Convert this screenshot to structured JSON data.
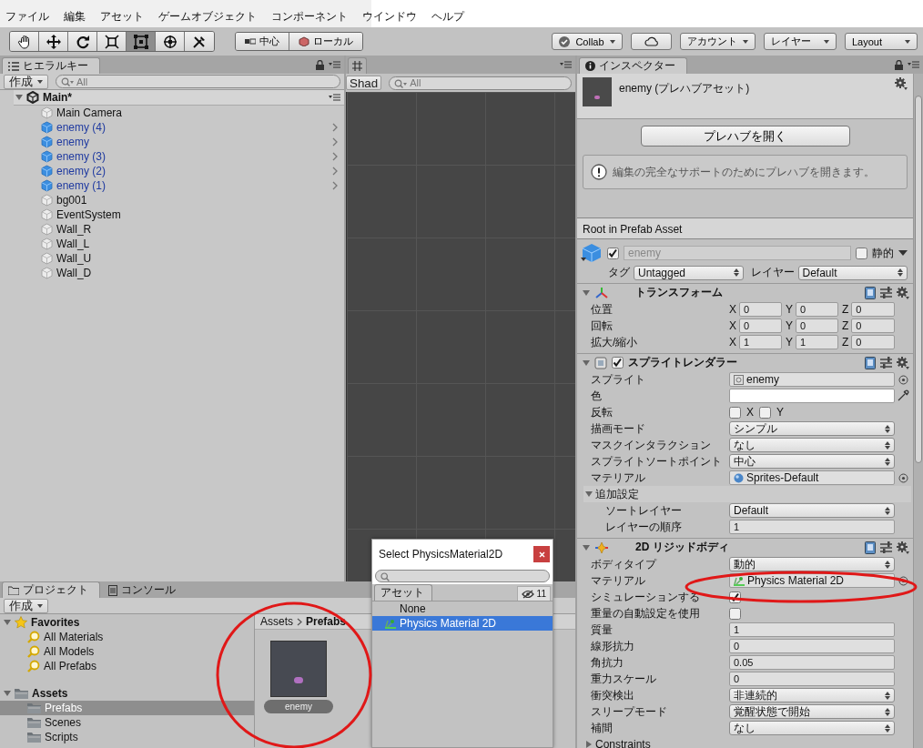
{
  "menu": [
    "ファイル",
    "編集",
    "アセット",
    "ゲームオブジェクト",
    "コンポーネント",
    "ウインドウ",
    "ヘルプ"
  ],
  "toolbar": {
    "tools": [
      {
        "kind": "hand",
        "selected": false
      },
      {
        "kind": "move",
        "selected": false
      },
      {
        "kind": "rotate",
        "selected": false
      },
      {
        "kind": "scale",
        "selected": false
      },
      {
        "kind": "rect",
        "selected": true
      },
      {
        "kind": "transform",
        "selected": false
      },
      {
        "kind": "custom",
        "selected": false
      }
    ],
    "pivot": [
      {
        "kind": "pivot",
        "label": "中心"
      },
      {
        "kind": "space",
        "label": "ローカル"
      }
    ],
    "right": [
      {
        "kind": "collab",
        "label": "Collab"
      },
      {
        "kind": "cloud"
      },
      {
        "kind": "dropdown",
        "label": "アカウント"
      },
      {
        "kind": "dropdown",
        "label": "レイヤー"
      },
      {
        "kind": "dropdown",
        "label": "Layout"
      }
    ]
  },
  "hierarchy": {
    "tab": "ヒエラルキー",
    "create": "作成",
    "placeholder": "All",
    "scene": {
      "name": "Main*",
      "expanded": true,
      "children": [
        {
          "name": "Main Camera",
          "prefab": false
        },
        {
          "name": "enemy (4)",
          "prefab": true
        },
        {
          "name": "enemy",
          "prefab": true
        },
        {
          "name": "enemy (3)",
          "prefab": true
        },
        {
          "name": "enemy (2)",
          "prefab": true
        },
        {
          "name": "enemy (1)",
          "prefab": true
        },
        {
          "name": "bg001",
          "prefab": false
        },
        {
          "name": "EventSystem",
          "prefab": false
        },
        {
          "name": "Wall_R",
          "prefab": false
        },
        {
          "name": "Wall_L",
          "prefab": false
        },
        {
          "name": "Wall_U",
          "prefab": false
        },
        {
          "name": "Wall_D",
          "prefab": false
        }
      ]
    }
  },
  "scene": {
    "shading": "Shad",
    "placeholder": "All"
  },
  "inspector": {
    "tab": "インスペクター",
    "title": "enemy (プレハブアセット)",
    "open_button": "プレハブを開く",
    "info": "編集の完全なサポートのためにプレハブを開きます。",
    "root_label": "Root in Prefab Asset",
    "object": {
      "active": true,
      "name": "enemy",
      "static_label": "静的",
      "static": false,
      "tag_label": "タグ",
      "tag": "Untagged",
      "layer_label": "レイヤー",
      "layer": "Default"
    },
    "components": [
      {
        "kind": "transform",
        "title": "トランスフォーム",
        "expanded": true,
        "rows": [
          {
            "kind": "vector3",
            "label": "位置",
            "values": [
              {
                "axis": "X",
                "value": "0"
              },
              {
                "axis": "Y",
                "value": "0"
              },
              {
                "axis": "Z",
                "value": "0"
              }
            ]
          },
          {
            "kind": "vector3",
            "label": "回転",
            "values": [
              {
                "axis": "X",
                "value": "0"
              },
              {
                "axis": "Y",
                "value": "0"
              },
              {
                "axis": "Z",
                "value": "0"
              }
            ]
          },
          {
            "kind": "vector3",
            "label": "拡大/縮小",
            "values": [
              {
                "axis": "X",
                "value": "1"
              },
              {
                "axis": "Y",
                "value": "1"
              },
              {
                "axis": "Z",
                "value": "0"
              }
            ]
          }
        ]
      },
      {
        "kind": "sprite_renderer",
        "title": "スプライトレンダラー",
        "expanded": true,
        "enabled": true,
        "rows": [
          {
            "kind": "sprite_field",
            "label": "スプライト",
            "value": "enemy"
          },
          {
            "kind": "color",
            "label": "色",
            "color": "#ffffff"
          },
          {
            "kind": "flags",
            "label": "反転",
            "options": [
              {
                "label": "X",
                "checked": false
              },
              {
                "label": "Y",
                "checked": false
              }
            ]
          },
          {
            "kind": "dropdown",
            "label": "描画モード",
            "value": "シンプル"
          },
          {
            "kind": "dropdown",
            "label": "マスクインタラクション",
            "value": "なし"
          },
          {
            "kind": "dropdown",
            "label": "スプライトソートポイント",
            "value": "中心"
          },
          {
            "kind": "material_field",
            "label": "マテリアル",
            "value": "Sprites-Default"
          },
          {
            "kind": "foldout",
            "label": "追加設定",
            "expanded": true,
            "children": [
              {
                "kind": "dropdown",
                "label": "ソートレイヤー",
                "value": "Default"
              },
              {
                "kind": "number",
                "label": "レイヤーの順序",
                "value": "1"
              }
            ]
          }
        ]
      },
      {
        "kind": "rigidbody",
        "title": "2D リジッドボディ",
        "expanded": true,
        "rows": [
          {
            "kind": "dropdown",
            "label": "ボディタイプ",
            "value": "動的"
          },
          {
            "kind": "physics_material_field",
            "label": "マテリアル",
            "value": "Physics Material 2D"
          },
          {
            "kind": "checkbox",
            "label": "シミュレーションする",
            "checked": true
          },
          {
            "kind": "checkbox",
            "label": "重量の自動設定を使用",
            "checked": false
          },
          {
            "kind": "number",
            "label": "質量",
            "value": "1"
          },
          {
            "kind": "number",
            "label": "線形抗力",
            "value": "0"
          },
          {
            "kind": "number",
            "label": "角抗力",
            "value": "0.05"
          },
          {
            "kind": "number",
            "label": "重力スケール",
            "value": "0"
          },
          {
            "kind": "dropdown",
            "label": "衝突検出",
            "value": "非連続的"
          },
          {
            "kind": "dropdown",
            "label": "スリープモード",
            "value": "覚醒状態で開始"
          },
          {
            "kind": "dropdown",
            "label": "補間",
            "value": "なし"
          },
          {
            "kind": "foldout",
            "label": "Constraints",
            "expanded": false
          }
        ]
      }
    ]
  },
  "project": {
    "tabs": [
      {
        "kind": "project",
        "label": "プロジェクト",
        "selected": true
      },
      {
        "kind": "console",
        "label": "コンソール",
        "selected": false
      }
    ],
    "create": "作成",
    "tree": [
      {
        "kind": "favorites",
        "label": "Favorites",
        "expanded": true,
        "selected": false,
        "children": [
          {
            "kind": "search",
            "label": "All Materials",
            "selected": false
          },
          {
            "kind": "search",
            "label": "All Models",
            "selected": false
          },
          {
            "kind": "search",
            "label": "All Prefabs",
            "selected": false
          }
        ]
      },
      {
        "kind": "folder",
        "label": "Assets",
        "expanded": true,
        "selected": false,
        "children": [
          {
            "kind": "folder",
            "label": "Prefabs",
            "selected": true
          },
          {
            "kind": "folder",
            "label": "Scenes",
            "selected": false
          },
          {
            "kind": "folder",
            "label": "Scripts",
            "selected": false
          }
        ]
      }
    ],
    "breadcrumb": [
      "Assets",
      "Prefabs"
    ],
    "assets": [
      {
        "name": "enemy",
        "selected": true
      }
    ]
  },
  "picker": {
    "title": "Select PhysicsMaterial2D",
    "tab": "アセット",
    "hidden_count": "11",
    "items": [
      {
        "label": "None",
        "selected": false
      },
      {
        "label": "Physics Material 2D",
        "selected": true
      }
    ]
  }
}
